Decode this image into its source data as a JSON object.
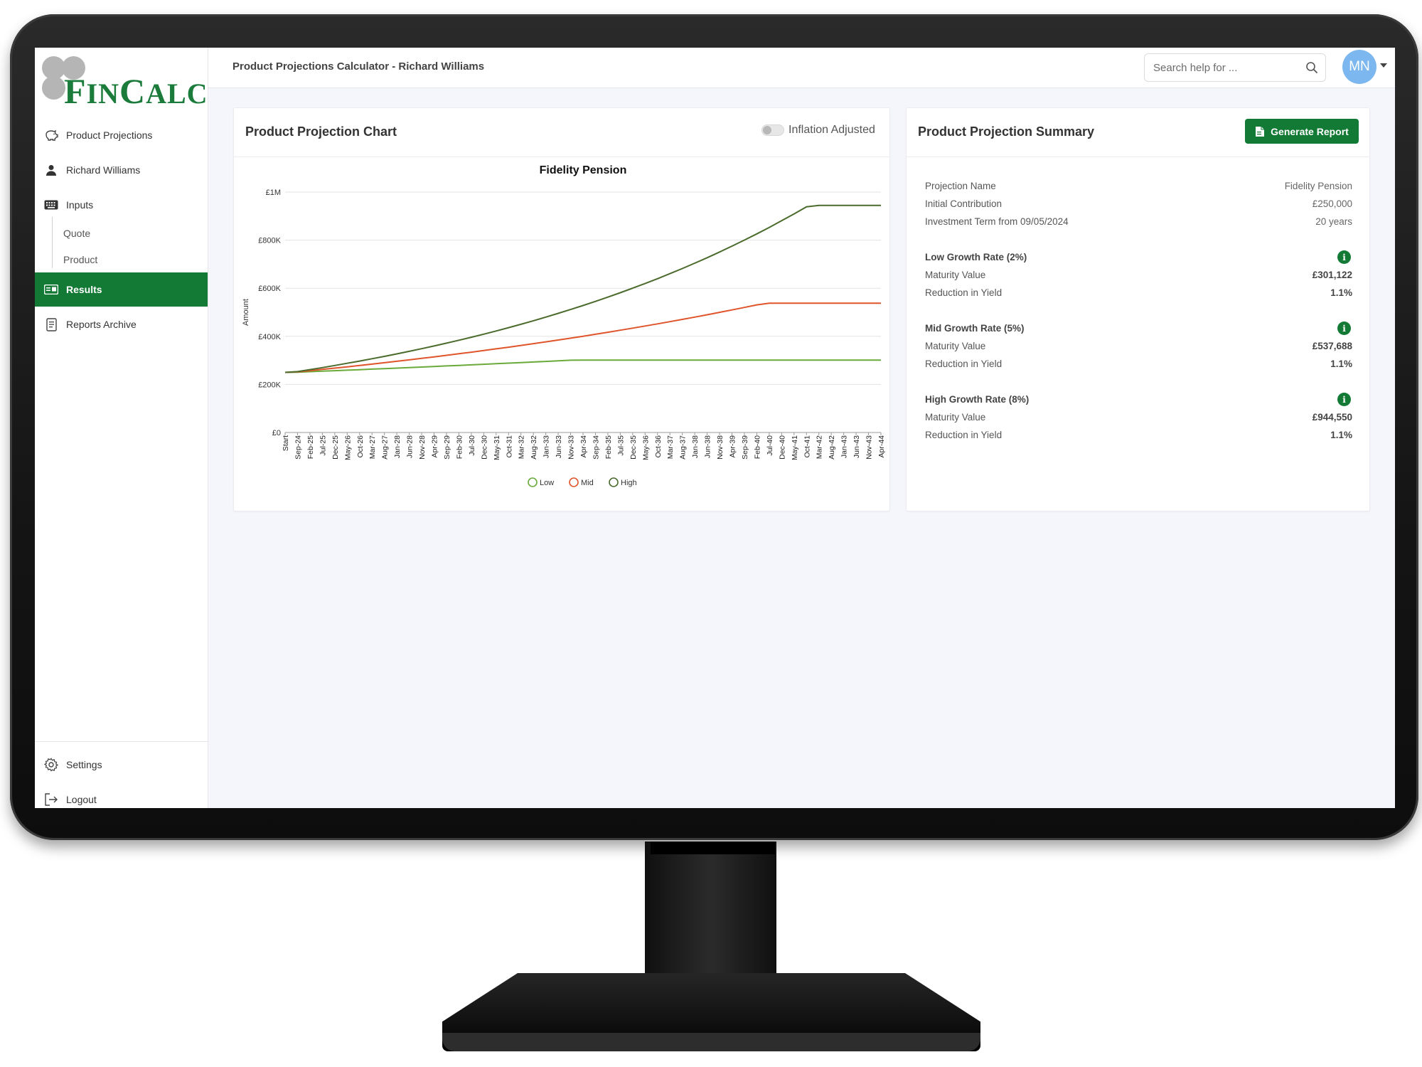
{
  "app": {
    "logo_text": "FinCalc",
    "header_title": "Product Projections Calculator - Richard Williams"
  },
  "search": {
    "placeholder": "Search help for ..."
  },
  "user": {
    "initials": "MN"
  },
  "sidebar": {
    "items": [
      {
        "label": "Product Projections",
        "icon": "piggy-bank-icon"
      },
      {
        "label": "Richard Williams",
        "icon": "user-icon"
      },
      {
        "label": "Inputs",
        "icon": "keyboard-icon"
      },
      {
        "label": "Results",
        "icon": "results-card-icon",
        "active": true
      },
      {
        "label": "Reports Archive",
        "icon": "document-icon"
      }
    ],
    "sub_items": [
      {
        "label": "Quote"
      },
      {
        "label": "Product"
      }
    ],
    "bottom_items": [
      {
        "label": "Settings",
        "icon": "gear-icon"
      },
      {
        "label": "Logout",
        "icon": "logout-icon"
      }
    ]
  },
  "chart_card": {
    "title": "Product Projection Chart",
    "toggle_label": "Inflation Adjusted",
    "toggle_on": false
  },
  "summary_card": {
    "title": "Product Projection Summary",
    "generate_label": "Generate Report",
    "rows": [
      {
        "label": "Projection Name",
        "value": "Fidelity Pension"
      },
      {
        "label": "Initial Contribution",
        "value": "£250,000"
      },
      {
        "label": "Investment Term from 09/05/2024",
        "value": "20 years"
      }
    ],
    "rates": [
      {
        "heading": "Low Growth Rate (2%)",
        "maturity_label": "Maturity Value",
        "maturity_value": "£301,122",
        "ry_label": "Reduction in Yield",
        "ry_value": "1.1%"
      },
      {
        "heading": "Mid Growth Rate (5%)",
        "maturity_label": "Maturity Value",
        "maturity_value": "£537,688",
        "ry_label": "Reduction in Yield",
        "ry_value": "1.1%"
      },
      {
        "heading": "High Growth Rate (8%)",
        "maturity_label": "Maturity Value",
        "maturity_value": "£944,550",
        "ry_label": "Reduction in Yield",
        "ry_value": "1.1%"
      }
    ]
  },
  "colors": {
    "brand_green": "#137a35",
    "low": "#6aaa3a",
    "mid": "#e0542b",
    "high": "#4a6b2c",
    "avatar": "#7cb8ef"
  },
  "chart_data": {
    "type": "line",
    "title": "Fidelity Pension",
    "ylabel": "Amount",
    "xlabel": "",
    "ylim": [
      0,
      1000000
    ],
    "y_ticks": [
      {
        "value": 0,
        "label": "£0"
      },
      {
        "value": 200000,
        "label": "£200K"
      },
      {
        "value": 400000,
        "label": "£400K"
      },
      {
        "value": 600000,
        "label": "£600K"
      },
      {
        "value": 800000,
        "label": "£800K"
      },
      {
        "value": 1000000,
        "label": "£1M"
      }
    ],
    "categories": [
      "Start",
      "Sep-24",
      "Feb-25",
      "Jul-25",
      "Dec-25",
      "May-26",
      "Oct-26",
      "Mar-27",
      "Aug-27",
      "Jan-28",
      "Jun-28",
      "Nov-28",
      "Apr-29",
      "Sep-29",
      "Feb-30",
      "Jul-30",
      "Dec-30",
      "May-31",
      "Oct-31",
      "Mar-32",
      "Aug-32",
      "Jan-33",
      "Jun-33",
      "Nov-33",
      "Apr-34",
      "Sep-34",
      "Feb-35",
      "Jul-35",
      "Dec-35",
      "May-36",
      "Oct-36",
      "Mar-37",
      "Aug-37",
      "Jan-38",
      "Jun-38",
      "Nov-38",
      "Apr-39",
      "Sep-39",
      "Feb-40",
      "Jul-40",
      "Dec-40",
      "May-41",
      "Oct-41",
      "Mar-42",
      "Aug-42",
      "Jan-43",
      "Jun-43",
      "Nov-43",
      "Apr-44"
    ],
    "series": [
      {
        "name": "Low",
        "color": "#6aaa3a",
        "values": [
          250000,
          250831,
          252899,
          254984,
          257086,
          259206,
          261343,
          263498,
          265670,
          267861,
          270069,
          272296,
          274541,
          276804,
          279087,
          281388,
          283708,
          286047,
          288406,
          290784,
          293181,
          295599,
          298036,
          300493,
          301122,
          301122,
          301122,
          301122,
          301122,
          301122,
          301122,
          301122,
          301122,
          301122,
          301122,
          301122,
          301122,
          301122,
          301122,
          301122,
          301122,
          301122,
          301122,
          301122,
          301122,
          301122,
          301122,
          301122,
          301122
        ]
      },
      {
        "name": "Mid",
        "color": "#e0542b",
        "values": [
          250000,
          252038,
          257162,
          262390,
          267724,
          273167,
          278720,
          284386,
          290168,
          296067,
          302086,
          308227,
          314493,
          320886,
          327410,
          334066,
          340857,
          347787,
          354857,
          362071,
          369432,
          376942,
          384605,
          392424,
          400401,
          408541,
          416846,
          425321,
          433967,
          442789,
          451790,
          460975,
          470346,
          479908,
          489664,
          499619,
          509776,
          520139,
          530713,
          537688,
          537688,
          537688,
          537688,
          537688,
          537688,
          537688,
          537688,
          537688,
          537688
        ]
      },
      {
        "name": "High",
        "color": "#4a6b2c",
        "values": [
          250000,
          253226,
          261450,
          269941,
          278708,
          287759,
          297104,
          306753,
          316715,
          327001,
          337621,
          348585,
          359906,
          371594,
          383662,
          396122,
          408986,
          422268,
          435982,
          450141,
          464760,
          479853,
          495437,
          511526,
          528138,
          545290,
          562999,
          581283,
          600160,
          619651,
          639775,
          660552,
          682004,
          704153,
          727021,
          750632,
          775010,
          800179,
          826166,
          852996,
          880698,
          909300,
          938831,
          944550,
          944550,
          944550,
          944550,
          944550,
          944550
        ]
      }
    ],
    "legend": [
      "Low",
      "Mid",
      "High"
    ],
    "legend_position": "bottom",
    "grid": true
  }
}
